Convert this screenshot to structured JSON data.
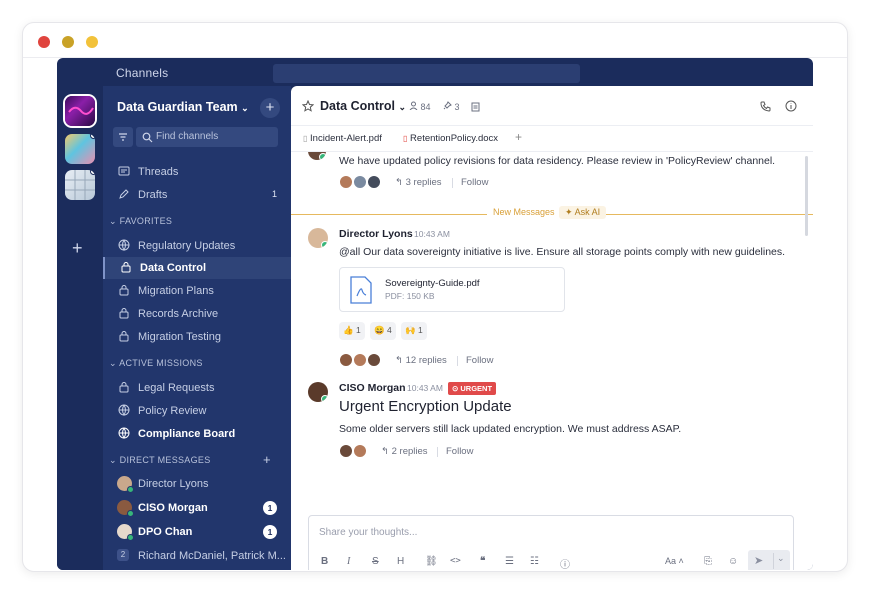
{
  "topbar": {
    "title": "Channels"
  },
  "sidebar": {
    "team_name": "Data Guardian Team",
    "find_placeholder": "Find channels",
    "threads_label": "Threads",
    "drafts_label": "Drafts",
    "drafts_count": "1",
    "favorites_title": "FAVORITES",
    "favorites": [
      {
        "label": "Regulatory Updates",
        "icon": "globe-icon"
      },
      {
        "label": "Data Control",
        "icon": "lock-icon"
      },
      {
        "label": "Migration Plans",
        "icon": "lock-icon"
      },
      {
        "label": "Records Archive",
        "icon": "lock-icon"
      },
      {
        "label": "Migration Testing",
        "icon": "lock-icon"
      }
    ],
    "missions_title": "ACTIVE MISSIONS",
    "missions": [
      {
        "label": "Legal Requests",
        "icon": "lock-icon"
      },
      {
        "label": "Policy Review",
        "icon": "globe-icon"
      },
      {
        "label": "Compliance Board",
        "icon": "globe-icon"
      }
    ],
    "dm_title": "DIRECT MESSAGES",
    "dms": [
      {
        "label": "Director Lyons",
        "badge": ""
      },
      {
        "label": "CISO Morgan",
        "badge": "1"
      },
      {
        "label": "DPO Chan",
        "badge": "1"
      },
      {
        "label": "Richard McDaniel, Patrick M...",
        "group_count": "2"
      }
    ]
  },
  "channel": {
    "name": "Data Control",
    "members": "84",
    "pinned": "3",
    "tabs": [
      "Incident-Alert.pdf",
      "RetentionPolicy.docx"
    ]
  },
  "messages": {
    "prev_text": "We have updated policy revisions for data residency. Please review in 'PolicyReview' channel.",
    "prev_replies": "3 replies",
    "follow": "Follow",
    "new_label": "New Messages",
    "ask_ai": "Ask AI",
    "m1": {
      "author": "Director Lyons",
      "time": "10:43 AM",
      "text": "@all Our data sovereignty initiative is live. Ensure all storage points comply with new guidelines.",
      "file_name": "Sovereignty-Guide.pdf",
      "file_meta": "PDF: 150 KB",
      "reactions": [
        {
          "emoji": "👍",
          "count": "1"
        },
        {
          "emoji": "😄",
          "count": "4"
        },
        {
          "emoji": "🙌",
          "count": "1"
        }
      ],
      "replies": "12 replies"
    },
    "m2": {
      "author": "CISO Morgan",
      "time": "10:43 AM",
      "tag": "URGENT",
      "title": "Urgent Encryption Update",
      "text": "Some older servers still lack updated encryption. We must address ASAP.",
      "replies": "2 replies"
    }
  },
  "composer": {
    "placeholder": "Share your thoughts...",
    "font_label": "Aa"
  },
  "colors": {
    "sidebar": "#22366c",
    "rail": "#1b2c5c",
    "accent_new": "#d9a13a",
    "urgent": "#e04a4a",
    "online": "#37b67a"
  }
}
